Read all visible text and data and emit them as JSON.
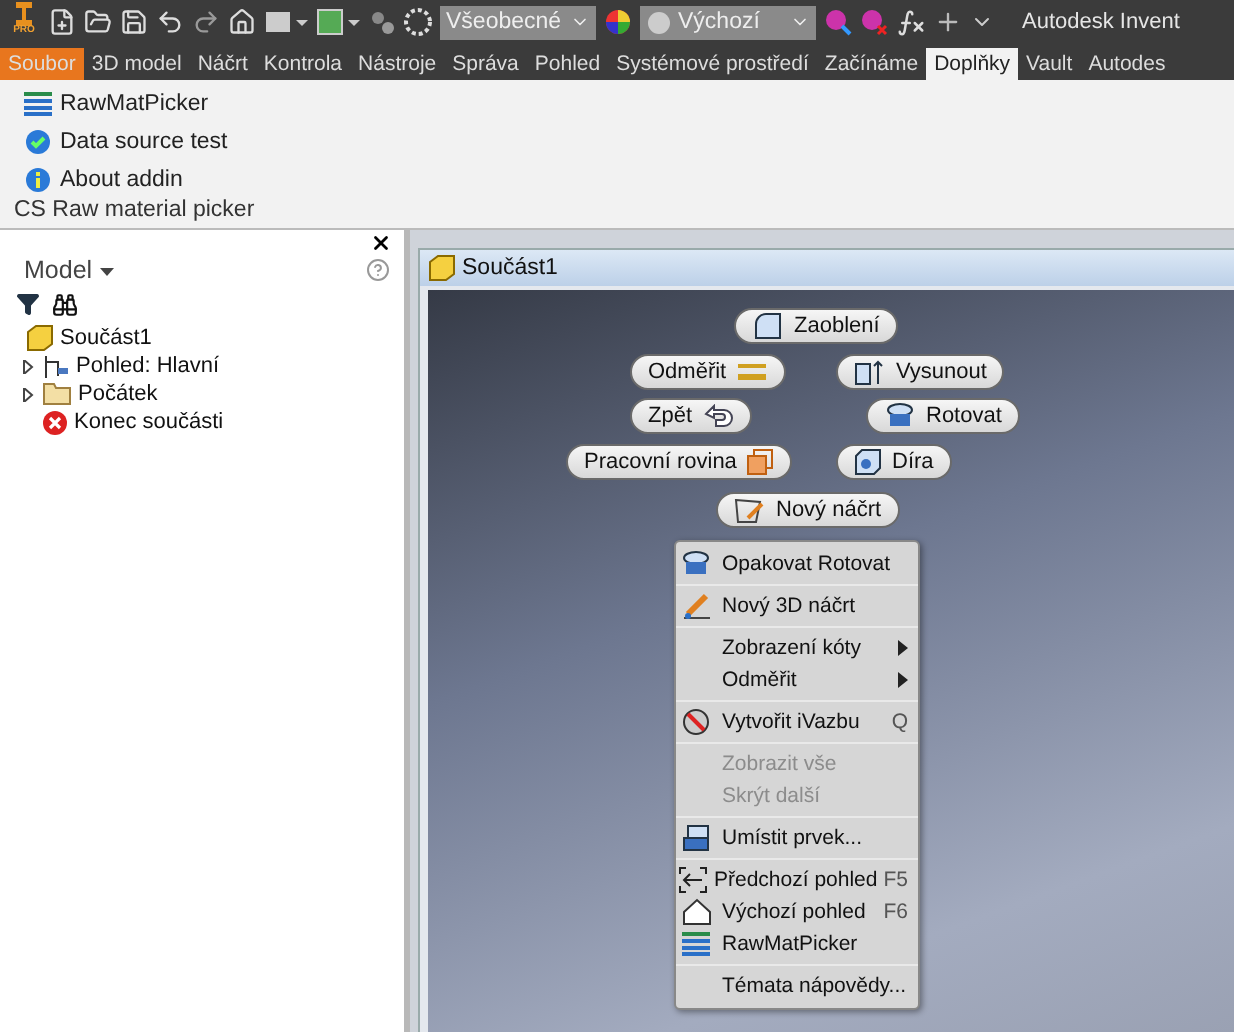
{
  "app_badge": "PRO",
  "toolbar": {
    "style_dropdown": "Všeobecné",
    "appearance_dropdown": "Výchozí",
    "title": "Autodesk Invent"
  },
  "tabs": [
    {
      "label": "Soubor",
      "kind": "file",
      "selected": false
    },
    {
      "label": "3D model",
      "kind": "tab",
      "selected": false
    },
    {
      "label": "Náčrt",
      "kind": "tab",
      "selected": false
    },
    {
      "label": "Kontrola",
      "kind": "tab",
      "selected": false
    },
    {
      "label": "Nástroje",
      "kind": "tab",
      "selected": false
    },
    {
      "label": "Správa",
      "kind": "tab",
      "selected": false
    },
    {
      "label": "Pohled",
      "kind": "tab",
      "selected": false
    },
    {
      "label": "Systémové prostředí",
      "kind": "tab",
      "selected": false
    },
    {
      "label": "Začínáme",
      "kind": "tab",
      "selected": false
    },
    {
      "label": "Doplňky",
      "kind": "tab",
      "selected": true
    },
    {
      "label": "Vault",
      "kind": "tab",
      "selected": false
    },
    {
      "label": "Autodes",
      "kind": "tab",
      "selected": false
    }
  ],
  "ribbon": {
    "commands": [
      {
        "label": "RawMatPicker",
        "kind": "list"
      },
      {
        "label": "Data source test",
        "kind": "check"
      },
      {
        "label": "About addin",
        "kind": "info"
      }
    ],
    "panel_title": "CS Raw material picker"
  },
  "browser": {
    "title": "Model",
    "tree": [
      {
        "label": "Součást1",
        "kind": "part",
        "children": [
          {
            "label": "Pohled: Hlavní",
            "kind": "view",
            "expanded": false
          },
          {
            "label": "Počátek",
            "kind": "folder",
            "expanded": false
          },
          {
            "label": "Konec součásti",
            "kind": "end"
          }
        ]
      }
    ]
  },
  "document": {
    "title": "Součást1"
  },
  "marking_menu": [
    {
      "label": "Zaoblení",
      "kind": "fillet"
    },
    {
      "label": "Odměřit",
      "kind": "measure"
    },
    {
      "label": "Vysunout",
      "kind": "extrude"
    },
    {
      "label": "Zpět",
      "kind": "undo"
    },
    {
      "label": "Rotovat",
      "kind": "revolve"
    },
    {
      "label": "Pracovní rovina",
      "kind": "plane"
    },
    {
      "label": "Díra",
      "kind": "hole"
    },
    {
      "label": "Nový náčrt",
      "kind": "sketch"
    }
  ],
  "context_menu": [
    [
      {
        "label": "Opakovat Rotovat",
        "kind": "revolve",
        "disabled": false
      }
    ],
    [
      {
        "label": "Nový 3D náčrt",
        "kind": "sketch3d",
        "disabled": false
      }
    ],
    [
      {
        "label": "Zobrazení kóty",
        "submenu": true,
        "disabled": false
      },
      {
        "label": "Odměřit",
        "submenu": true,
        "disabled": false
      }
    ],
    [
      {
        "label": "Vytvořit iVazbu",
        "kind": "constraint",
        "shortcut": "Q",
        "disabled": false
      }
    ],
    [
      {
        "label": "Zobrazit vše",
        "disabled": true
      },
      {
        "label": "Skrýt další",
        "disabled": true
      }
    ],
    [
      {
        "label": "Umístit prvek...",
        "kind": "place",
        "disabled": false
      }
    ],
    [
      {
        "label": "Předchozí pohled",
        "kind": "prev",
        "shortcut": "F5",
        "disabled": false
      },
      {
        "label": "Výchozí pohled",
        "kind": "home",
        "shortcut": "F6",
        "disabled": false
      },
      {
        "label": "RawMatPicker",
        "kind": "list",
        "disabled": false
      }
    ],
    [
      {
        "label": "Témata nápovědy...",
        "disabled": false
      }
    ]
  ]
}
